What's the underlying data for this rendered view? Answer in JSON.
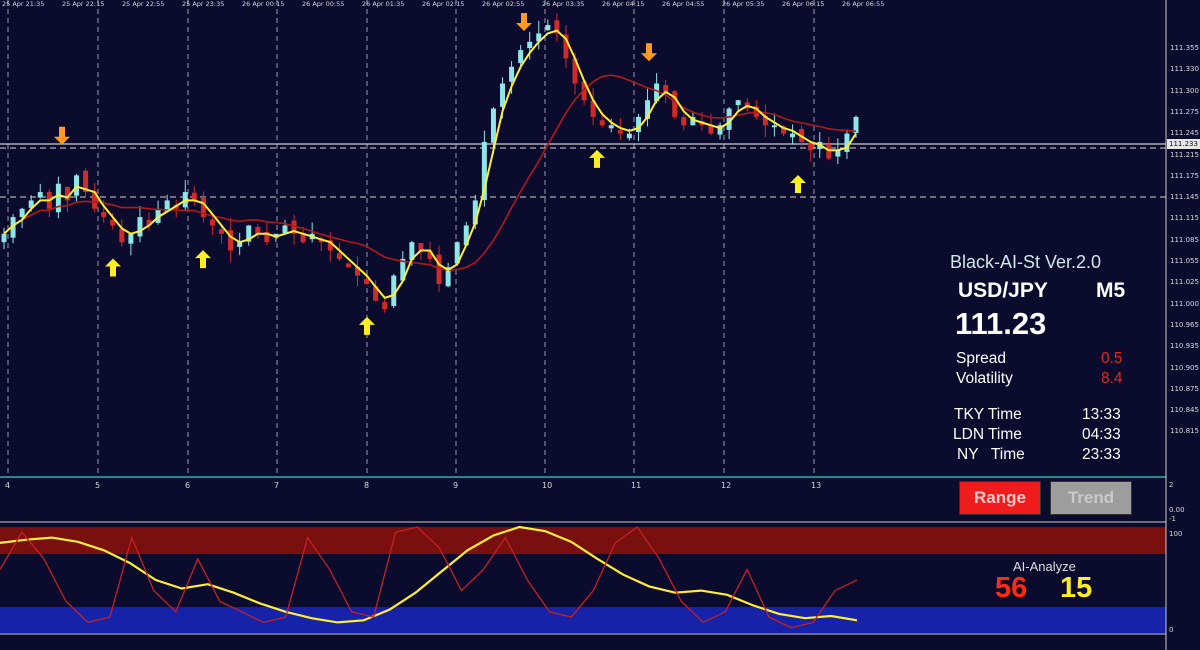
{
  "indicator": {
    "title": "Black-AI-St Ver.2.0",
    "pair": "USD/JPY",
    "timeframe": "M5",
    "price": "111.23",
    "spread_label": "Spread",
    "spread_value": "0.5",
    "volatility_label": "Volatility",
    "volatility_value": "8.4",
    "tky_label": "TKY Time",
    "tky_value": "13:33",
    "ldn_label": "LDN Time",
    "ldn_value": "04:33",
    "ny_label": "NY   Time",
    "ny_value": "23:33"
  },
  "buttons": {
    "range": "Range",
    "trend": "Trend"
  },
  "ai_analyze": {
    "label": "AI-Analyze",
    "value_red": "56",
    "value_yellow": "15"
  },
  "price_axis_ticks": [
    "111.355",
    "111.330",
    "111.300",
    "111.275",
    "111.245",
    "111.215",
    "111.175",
    "111.145",
    "111.115",
    "111.085",
    "111.055",
    "111.025",
    "111.000",
    "110.965",
    "110.935",
    "110.905",
    "110.875",
    "110.845",
    "110.815"
  ],
  "price_axis_current": "111.233",
  "session_labels": [
    "4",
    "5",
    "6",
    "7",
    "8",
    "9",
    "10",
    "11",
    "12",
    "13"
  ],
  "sub_axis_ticks": [
    "2",
    "0.00",
    "-1",
    "100",
    "0"
  ],
  "date_labels": [
    "25 Apr 21:35",
    "25 Apr 22:15",
    "25 Apr 22:55",
    "25 Apr 23:35",
    "26 Apr 00:15",
    "26 Apr 00:55",
    "26 Apr 01:35",
    "26 Apr 02:15",
    "26 Apr 02:55",
    "26 Apr 03:35",
    "26 Apr 04:15",
    "26 Apr 04:55",
    "26 Apr 05:35",
    "26 Apr 06:15",
    "26 Apr 06:55"
  ],
  "colors": {
    "background": "#0b0b2e",
    "bull_candle": "#8ee6e6",
    "bear_candle": "#d22a2a",
    "fast_ma": "#ffee33",
    "slow_ma": "#b01a1a",
    "arrow_up": "#ffee22",
    "arrow_down": "#ff9922",
    "overbought_zone": "#7a0f10",
    "oversold_zone": "#1622a8"
  },
  "chart_data": {
    "type": "candlestick",
    "y_range": [
      110.8,
      111.37
    ],
    "close_series": [
      111.09,
      111.11,
      111.12,
      111.13,
      111.14,
      111.12,
      111.15,
      111.13,
      111.16,
      111.14,
      111.12,
      111.11,
      111.1,
      111.08,
      111.09,
      111.11,
      111.1,
      111.12,
      111.13,
      111.12,
      111.14,
      111.13,
      111.11,
      111.1,
      111.09,
      111.07,
      111.08,
      111.1,
      111.09,
      111.08,
      111.09,
      111.1,
      111.09,
      111.08,
      111.09,
      111.08,
      111.07,
      111.06,
      111.05,
      111.04,
      111.03,
      111.01,
      111.0,
      111.04,
      111.06,
      111.08,
      111.07,
      111.06,
      111.03,
      111.05,
      111.08,
      111.1,
      111.13,
      111.2,
      111.24,
      111.27,
      111.29,
      111.31,
      111.32,
      111.33,
      111.34,
      111.33,
      111.3,
      111.27,
      111.25,
      111.23,
      111.22,
      111.22,
      111.21,
      111.21,
      111.23,
      111.25,
      111.27,
      111.26,
      111.23,
      111.22,
      111.23,
      111.22,
      111.21,
      111.22,
      111.24,
      111.25,
      111.24,
      111.23,
      111.22,
      111.22,
      111.21,
      111.21,
      111.2,
      111.19,
      111.2,
      111.18,
      111.19,
      111.21,
      111.23
    ],
    "signals": {
      "buy_arrows_x": [
        113,
        203,
        367,
        597,
        798
      ],
      "sell_arrows_x": [
        62,
        524,
        649
      ]
    },
    "oscillator": {
      "upper_level": 100,
      "lower_level": 0
    }
  }
}
